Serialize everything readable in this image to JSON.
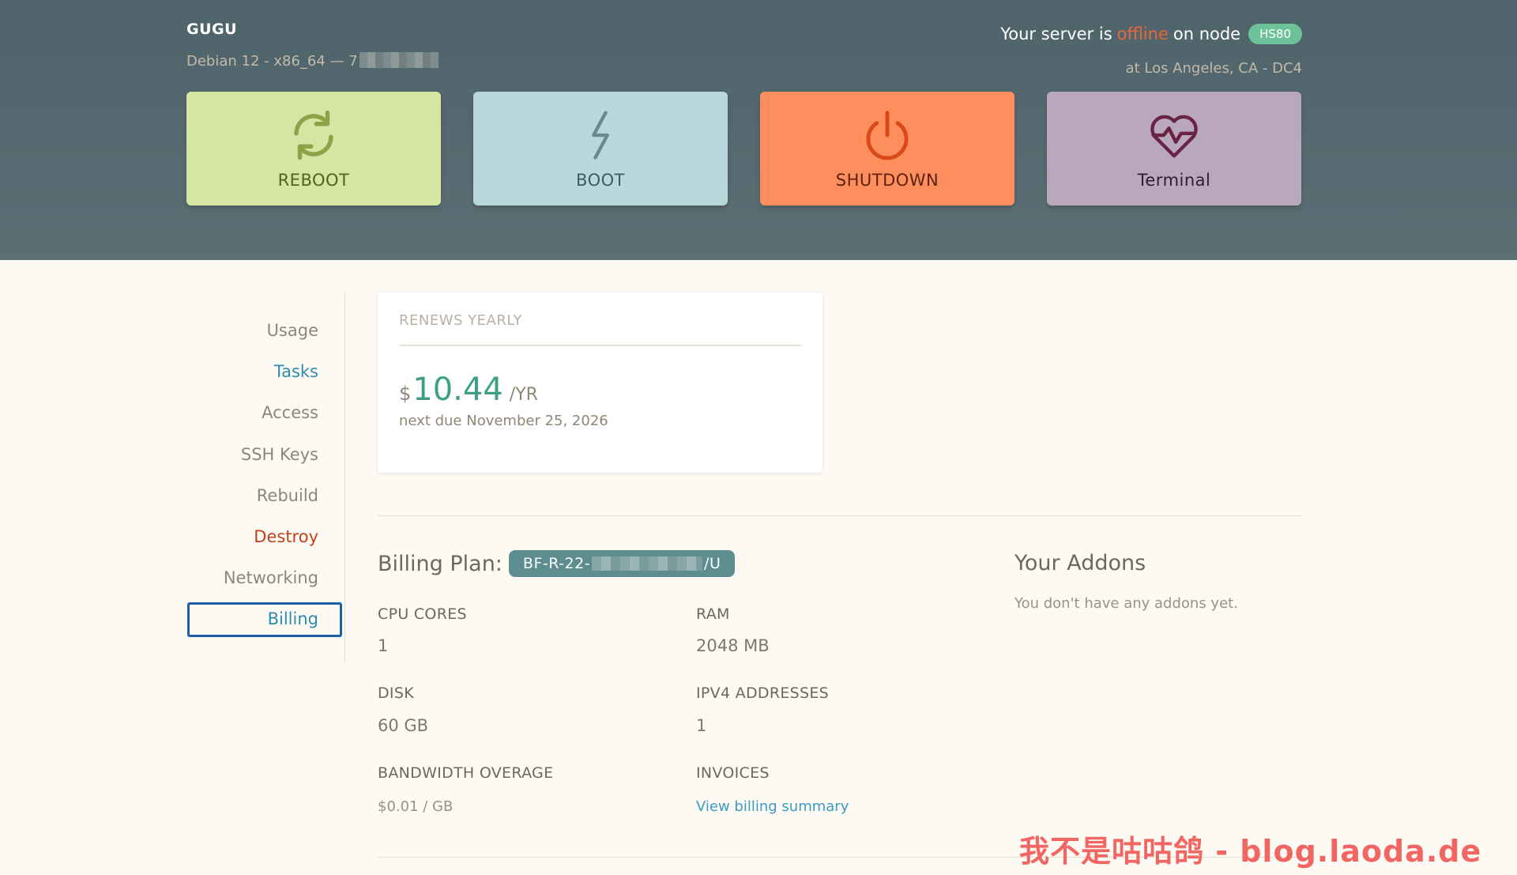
{
  "server": {
    "name": "GUGU",
    "os_prefix": "Debian 12 - x86_64 — 7",
    "status_prefix": "Your server is",
    "status": "offline",
    "status_mid": "on node",
    "node": "HS80",
    "location": "at Los Angeles, CA - DC4"
  },
  "actions": {
    "reboot": "REBOOT",
    "boot": "BOOT",
    "shutdown": "SHUTDOWN",
    "terminal": "Terminal"
  },
  "sidebar": {
    "items": [
      {
        "label": "Usage"
      },
      {
        "label": "Tasks"
      },
      {
        "label": "Access"
      },
      {
        "label": "SSH Keys"
      },
      {
        "label": "Rebuild"
      },
      {
        "label": "Destroy"
      },
      {
        "label": "Networking"
      },
      {
        "label": "Billing"
      }
    ],
    "active": "Billing"
  },
  "renewal": {
    "title": "RENEWS YEARLY",
    "currency": "$",
    "amount": "10.44",
    "period": "/YR",
    "next_due": "next due November 25, 2026"
  },
  "billing": {
    "plan_label": "Billing Plan:",
    "plan_prefix": "BF-R-22-",
    "plan_suffix": "/U",
    "specs": {
      "cpu_label": "CPU CORES",
      "cpu_value": "1",
      "ram_label": "RAM",
      "ram_value": "2048 MB",
      "disk_label": "DISK",
      "disk_value": "60 GB",
      "ipv4_label": "IPV4 ADDRESSES",
      "ipv4_value": "1",
      "bw_label": "BANDWIDTH OVERAGE",
      "bw_value": "$0.01 / GB",
      "invoices_label": "INVOICES",
      "invoices_link": "View billing summary"
    }
  },
  "addons": {
    "title": "Your Addons",
    "empty": "You don't have any addons yet."
  },
  "watermark": "我不是咕咕鸽 - blog.laoda.de",
  "colors": {
    "header_bg": "#4e646a",
    "reboot": "#d4e6a2",
    "boot": "#b8d9db",
    "shutdown": "#ff8e5e",
    "terminal": "#b9a8bb",
    "accent": "#2f8bb0",
    "danger": "#c1411d",
    "price": "#3c9f86",
    "node_badge": "#6cc39a",
    "plan_badge": "#5d8d8f"
  },
  "icons": {
    "reboot": "refresh-icon",
    "boot": "lightning-icon",
    "shutdown": "power-icon",
    "terminal": "heart-pulse-icon"
  }
}
